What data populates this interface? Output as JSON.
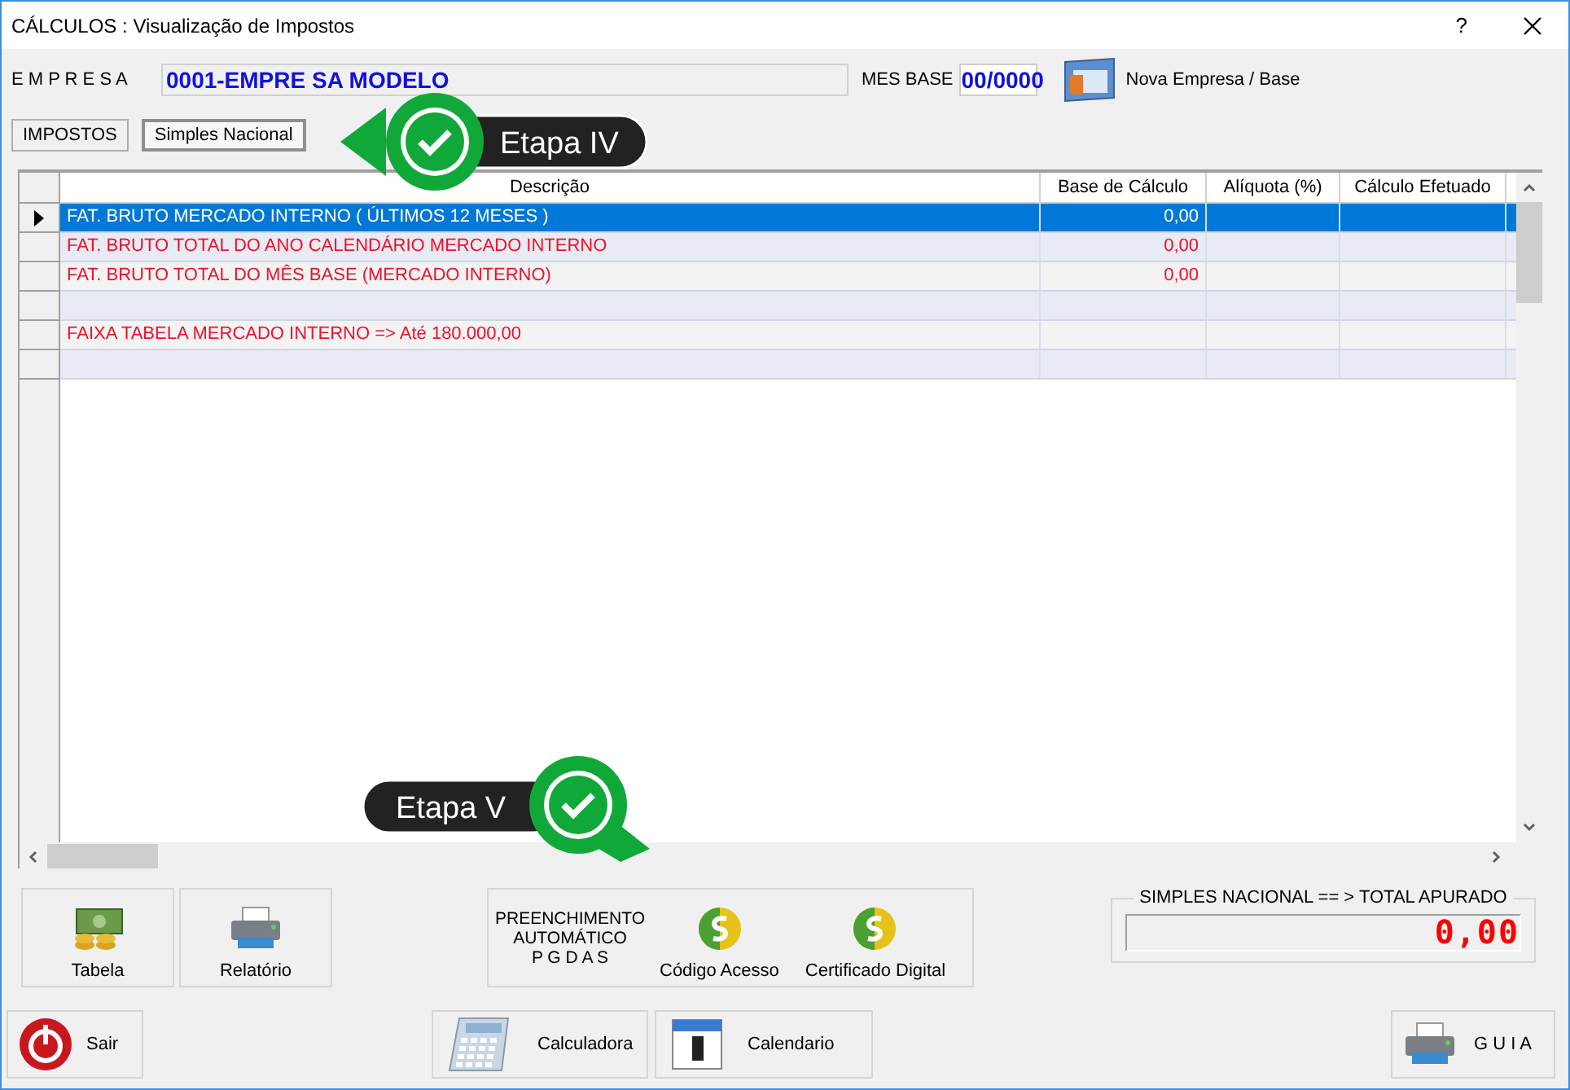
{
  "window": {
    "title": "CÁLCULOS : Visualização de Impostos",
    "help": "?"
  },
  "header": {
    "company_label": "E M P R E S A",
    "company": "0001-EMPRE SA MODELO",
    "month_label": "MES BASE",
    "month": "00/0000",
    "new_button": "Nova Empresa / Base"
  },
  "tabs": [
    {
      "label": "IMPOSTOS",
      "selected": false
    },
    {
      "label": "Simples Nacional",
      "selected": true
    }
  ],
  "grid": {
    "columns": [
      "Descrição",
      "Base de Cálculo",
      "Alíquota (%)",
      "Cálculo Efetuado"
    ],
    "rows": [
      {
        "description": "FAT. BRUTO MERCADO INTERNO ( ÚLTIMOS 12 MESES )",
        "base": "0,00",
        "selected": true
      },
      {
        "description": "FAT. BRUTO TOTAL DO ANO CALENDÁRIO MERCADO INTERNO",
        "base": "0,00",
        "selected": false
      },
      {
        "description": "FAT. BRUTO TOTAL DO MÊS BASE (MERCADO INTERNO)",
        "base": "0,00",
        "selected": false
      },
      {
        "selected": false
      },
      {
        "description": "FAIXA TABELA MERCADO INTERNO => Até 180.000,00",
        "selected": false
      },
      {
        "selected": false
      }
    ]
  },
  "tools": [
    {
      "label": "Tabela",
      "kind": "money"
    },
    {
      "label": "Relatório",
      "kind": "printer"
    }
  ],
  "pgdas": {
    "label_lines": [
      "PREENCHIMENTO",
      "AUTOMÁTICO",
      "P G D A S"
    ],
    "buttons": [
      {
        "label": "Código Acesso"
      },
      {
        "label": "Certificado Digital"
      }
    ]
  },
  "total": {
    "legend": "SIMPLES NACIONAL == > TOTAL APURADO",
    "value": "0,00"
  },
  "footer": [
    {
      "label": "Sair",
      "kind": "power"
    },
    {
      "label": "Calculadora",
      "kind": "calculator"
    },
    {
      "label": "Calendario",
      "kind": "calendar"
    },
    {
      "label": "G U I A",
      "kind": "printer"
    }
  ],
  "callouts": [
    {
      "label": "Etapa IV",
      "kind": "left"
    },
    {
      "label": "Etapa V",
      "kind": "right"
    }
  ]
}
